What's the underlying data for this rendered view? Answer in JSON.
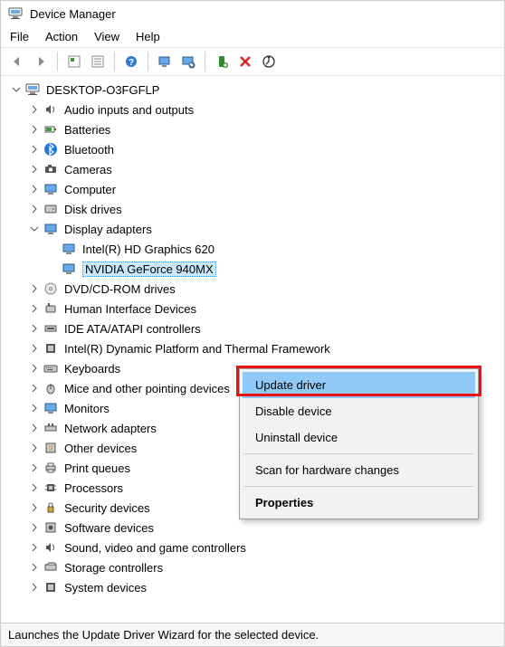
{
  "window": {
    "title": "Device Manager"
  },
  "menubar": {
    "file": "File",
    "action": "Action",
    "view": "View",
    "help": "Help"
  },
  "toolbar_icons": [
    "back",
    "forward",
    "show-hidden",
    "properties-sheet",
    "help",
    "monitor-refresh",
    "monitor-scan",
    "install",
    "remove",
    "update"
  ],
  "root": {
    "name": "DESKTOP-O3FGFLP"
  },
  "categories": [
    {
      "key": "audio",
      "label": "Audio inputs and outputs",
      "expanded": false
    },
    {
      "key": "batt",
      "label": "Batteries",
      "expanded": false
    },
    {
      "key": "bt",
      "label": "Bluetooth",
      "expanded": false
    },
    {
      "key": "cam",
      "label": "Cameras",
      "expanded": false
    },
    {
      "key": "comp",
      "label": "Computer",
      "expanded": false
    },
    {
      "key": "disk",
      "label": "Disk drives",
      "expanded": false
    },
    {
      "key": "disp",
      "label": "Display adapters",
      "expanded": true,
      "children": [
        {
          "label": "Intel(R) HD Graphics 620",
          "selected": false
        },
        {
          "label": "NVIDIA GeForce 940MX",
          "selected": true
        }
      ]
    },
    {
      "key": "dvd",
      "label": "DVD/CD-ROM drives",
      "expanded": false
    },
    {
      "key": "hid",
      "label": "Human Interface Devices",
      "expanded": false
    },
    {
      "key": "ide",
      "label": "IDE ATA/ATAPI controllers",
      "expanded": false
    },
    {
      "key": "dptf",
      "label": "Intel(R) Dynamic Platform and Thermal Framework",
      "expanded": false
    },
    {
      "key": "kbd",
      "label": "Keyboards",
      "expanded": false
    },
    {
      "key": "mouse",
      "label": "Mice and other pointing devices",
      "expanded": false
    },
    {
      "key": "mon",
      "label": "Monitors",
      "expanded": false
    },
    {
      "key": "net",
      "label": "Network adapters",
      "expanded": false
    },
    {
      "key": "other",
      "label": "Other devices",
      "expanded": false
    },
    {
      "key": "print",
      "label": "Print queues",
      "expanded": false
    },
    {
      "key": "cpu",
      "label": "Processors",
      "expanded": false
    },
    {
      "key": "sec",
      "label": "Security devices",
      "expanded": false
    },
    {
      "key": "swdev",
      "label": "Software devices",
      "expanded": false
    },
    {
      "key": "sound",
      "label": "Sound, video and game controllers",
      "expanded": false
    },
    {
      "key": "stor",
      "label": "Storage controllers",
      "expanded": false
    },
    {
      "key": "sysdev",
      "label": "System devices",
      "expanded": false
    }
  ],
  "context_menu": {
    "update": "Update driver",
    "disable": "Disable device",
    "uninstall": "Uninstall device",
    "scan": "Scan for hardware changes",
    "props": "Properties"
  },
  "statusbar": {
    "text": "Launches the Update Driver Wizard for the selected device."
  }
}
